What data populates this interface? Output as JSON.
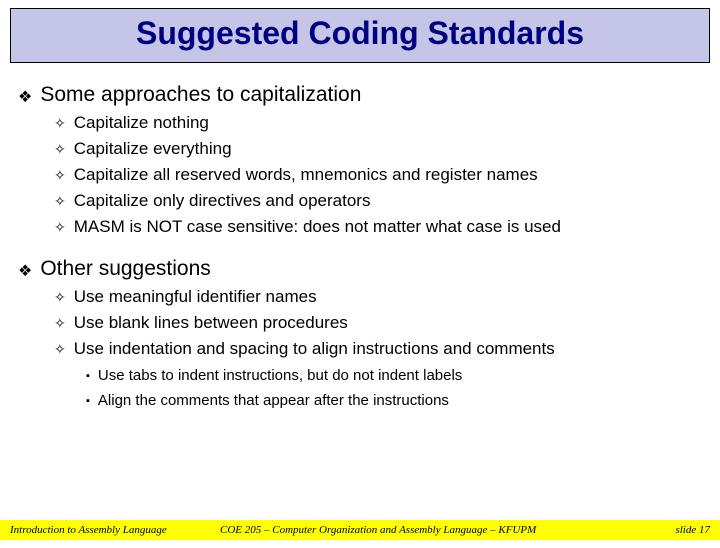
{
  "title": "Suggested Coding Standards",
  "sections": [
    {
      "heading": "Some approaches to capitalization",
      "items": [
        {
          "text": "Capitalize nothing"
        },
        {
          "text": "Capitalize everything"
        },
        {
          "text": "Capitalize all reserved words, mnemonics and register names"
        },
        {
          "text": "Capitalize only directives and operators"
        },
        {
          "text": "MASM is NOT case sensitive: does not matter what case is used"
        }
      ]
    },
    {
      "heading": "Other suggestions",
      "items": [
        {
          "text": "Use meaningful identifier names"
        },
        {
          "text": "Use blank lines between procedures"
        },
        {
          "text": "Use indentation and spacing to align instructions and comments",
          "sub": [
            "Use tabs to indent instructions, but do not indent labels",
            "Align the comments that appear after the instructions"
          ]
        }
      ]
    }
  ],
  "footer": {
    "left": "Introduction to Assembly Language",
    "center": "COE 205 – Computer Organization and Assembly Language – KFUPM",
    "right": "slide 17"
  },
  "bullets": {
    "lvl1": "❖",
    "lvl2": "✧",
    "lvl3": "▪"
  }
}
